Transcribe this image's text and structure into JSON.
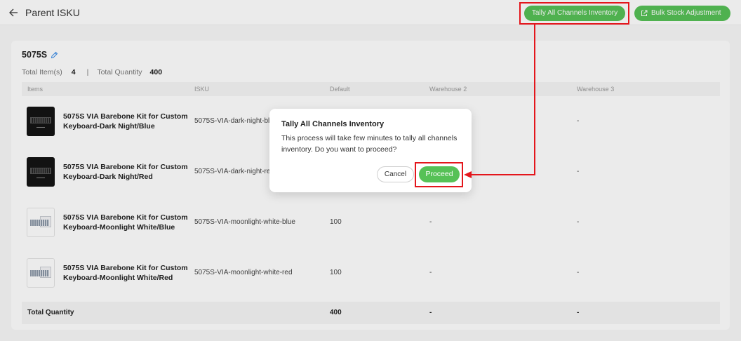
{
  "header": {
    "back_icon": "arrow-left-icon",
    "title": "Parent ISKU",
    "tally_button_label": "Tally All Channels Inventory",
    "bulk_button_icon": "external-link-icon",
    "bulk_button_label": "Bulk Stock Adjustment"
  },
  "summary": {
    "name": "5075S",
    "edit_icon": "pencil-icon",
    "total_items_label": "Total Item(s)",
    "total_items": "4",
    "separator": "|",
    "total_quantity_label": "Total Quantity",
    "total_quantity": "400"
  },
  "table": {
    "columns": [
      "Items",
      "ISKU",
      "Default",
      "Warehouse 2",
      "Warehouse 3"
    ],
    "rows": [
      {
        "name": "5075S VIA Barebone Kit for Custom Keyboard-Dark Night/Blue",
        "isku": "5075S-VIA-dark-night-bl",
        "warehouse_3": "-"
      },
      {
        "name": "5075S VIA Barebone Kit for Custom Keyboard-Dark Night/Red",
        "isku": "5075S-VIA-dark-night-re",
        "warehouse_3": "-"
      },
      {
        "name": "5075S VIA Barebone Kit for Custom Keyboard-Moonlight White/Blue",
        "isku": "5075S-VIA-moonlight-white-blue",
        "default": "100",
        "warehouse_2": "-",
        "warehouse_3": "-"
      },
      {
        "name": "5075S VIA Barebone Kit for Custom Keyboard-Moonlight White/Red",
        "isku": "5075S-VIA-moonlight-white-red",
        "default": "100",
        "warehouse_2": "-",
        "warehouse_3": "-"
      }
    ],
    "footer": {
      "label": "Total Quantity",
      "default": "400",
      "warehouse_2": "-",
      "warehouse_3": "-"
    }
  },
  "modal": {
    "title": "Tally All Channels Inventory",
    "body": "This process will take few minutes to tally all channels inventory. Do you want to proceed?",
    "cancel_label": "Cancel",
    "proceed_label": "Proceed"
  },
  "colors": {
    "primary_green": "#56c156",
    "edit_blue": "#3d8ee8",
    "annotation_red": "#e4161c",
    "backdrop": "rgba(0,0,0,0.08)"
  }
}
